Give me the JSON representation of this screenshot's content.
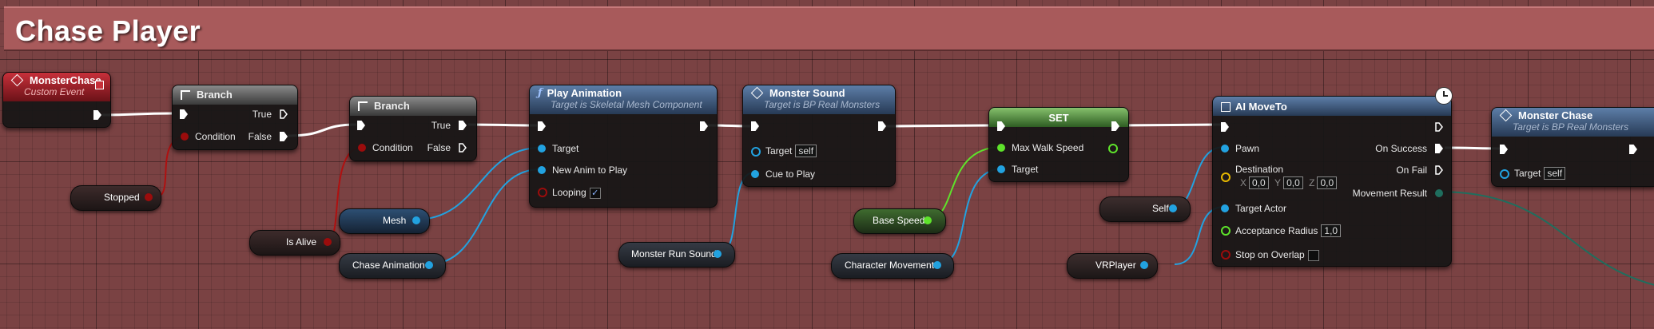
{
  "comment": {
    "title": "Chase Player"
  },
  "nodes": {
    "monster_chase_event": {
      "title": "MonsterChase",
      "subtitle": "Custom Event"
    },
    "branch1": {
      "title": "Branch",
      "condition": "Condition",
      "true_label": "True",
      "false_label": "False"
    },
    "branch2": {
      "title": "Branch",
      "condition": "Condition",
      "true_label": "True",
      "false_label": "False"
    },
    "play_animation": {
      "title": "Play Animation",
      "subtitle": "Target is Skeletal Mesh Component",
      "target": "Target",
      "new_anim": "New Anim to Play",
      "looping": "Looping",
      "looping_checked": "✓"
    },
    "monster_sound": {
      "title": "Monster Sound",
      "subtitle": "Target is BP Real Monsters",
      "target": "Target",
      "target_value": "self",
      "cue": "Cue to Play"
    },
    "set": {
      "title": "SET",
      "max_walk_speed": "Max Walk Speed",
      "target": "Target"
    },
    "ai_move_to": {
      "title": "AI MoveTo",
      "pawn": "Pawn",
      "destination": "Destination",
      "dest_x_label": "X",
      "dest_x": "0,0",
      "dest_y_label": "Y",
      "dest_y": "0,0",
      "dest_z_label": "Z",
      "dest_z": "0,0",
      "target_actor": "Target Actor",
      "acceptance_radius": "Acceptance Radius",
      "acceptance_value": "1,0",
      "stop_on_overlap": "Stop on Overlap",
      "on_success": "On Success",
      "on_fail": "On Fail",
      "movement_result": "Movement Result"
    },
    "monster_chase_call": {
      "title": "Monster Chase",
      "subtitle": "Target is BP Real Monsters",
      "target": "Target",
      "target_value": "self"
    }
  },
  "variables": {
    "stopped": "Stopped",
    "is_alive": "Is Alive",
    "mesh": "Mesh",
    "chase_animation": "Chase Animation",
    "monster_run_sound": "Monster Run Sound",
    "base_speed": "Base Speed",
    "character_movement": "Character Movement",
    "self": "Self",
    "vr_player": "VRPlayer"
  },
  "colors": {
    "exec": "#ffffff",
    "bool": "#9b0c0c",
    "object": "#22a2e0",
    "float": "#5ee32b",
    "struct": "#e6b800",
    "enum": "#1f6e5e",
    "comment_bar": "#a85a5b"
  }
}
